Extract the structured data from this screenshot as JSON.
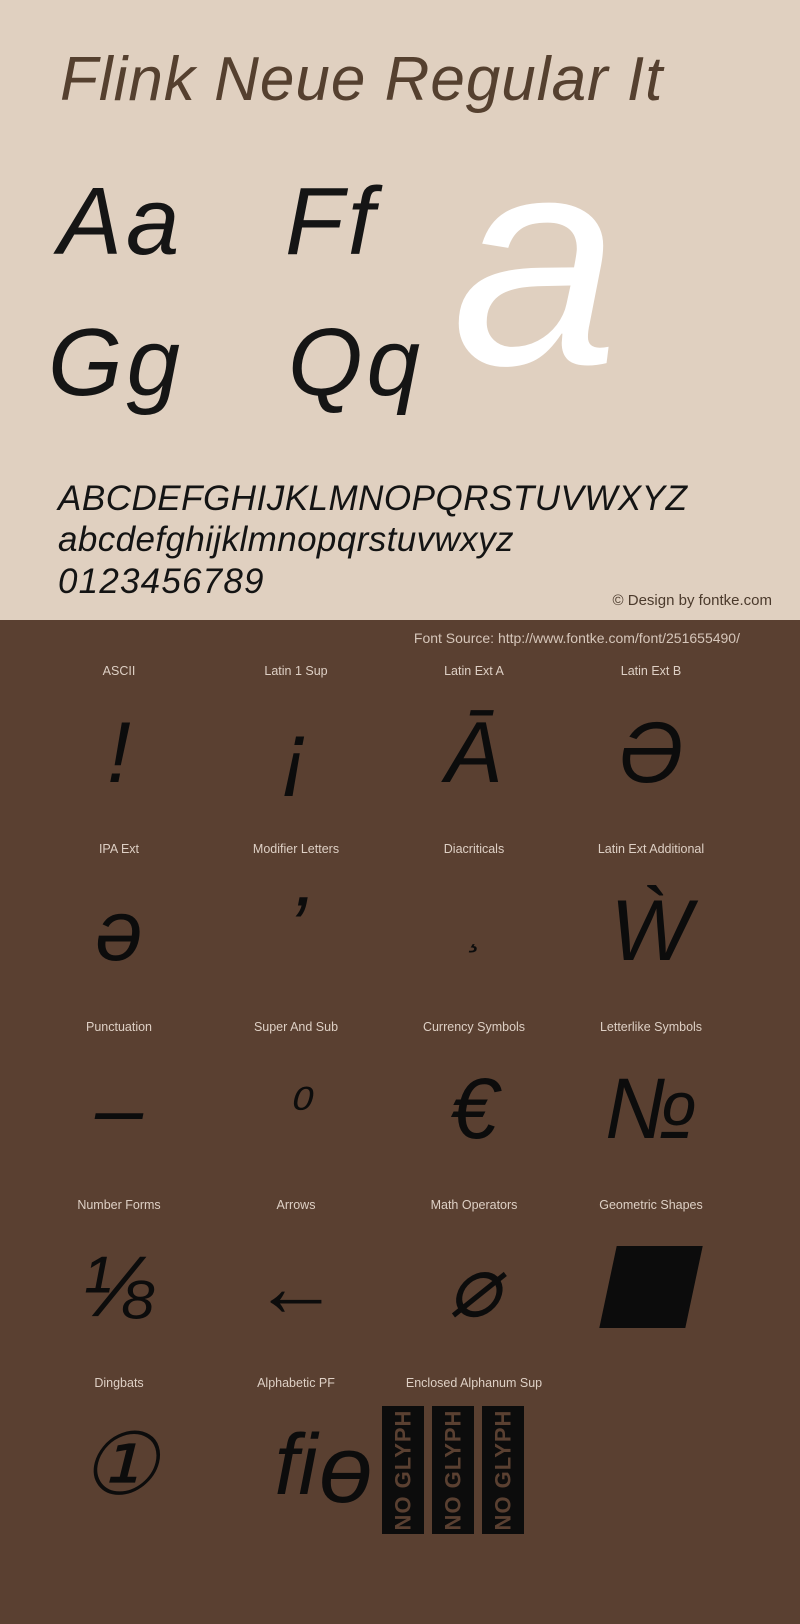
{
  "header": {
    "title": "Flink Neue Regular It"
  },
  "showcase": {
    "pairs": [
      "Aa",
      "Ff",
      "Gg",
      "Qq"
    ],
    "giant_glyph": "a"
  },
  "alphabet": {
    "uppercase": "ABCDEFGHIJKLMNOPQRSTUVWXYZ",
    "lowercase": "abcdefghijklmnopqrstuvwxyz",
    "digits": "0123456789"
  },
  "credit": "© Design by fontke.com",
  "source": "Font Source: http://www.fontke.com/font/251655490/",
  "unicode_blocks": [
    [
      {
        "label": "ASCII",
        "glyph": "!"
      },
      {
        "label": "Latin 1 Sup",
        "glyph": "¡"
      },
      {
        "label": "Latin Ext A",
        "glyph": "Ā"
      },
      {
        "label": "Latin Ext B",
        "glyph": "Ə"
      }
    ],
    [
      {
        "label": "IPA Ext",
        "glyph": "ə"
      },
      {
        "label": "Modifier Letters",
        "glyph": "ʼ"
      },
      {
        "label": "Diacriticals",
        "glyph": "̧"
      },
      {
        "label": "Latin Ext Additional",
        "glyph": "Ẁ"
      }
    ],
    [
      {
        "label": "Punctuation",
        "glyph": "–"
      },
      {
        "label": "Super And Sub",
        "glyph": "⁰"
      },
      {
        "label": "Currency Symbols",
        "glyph": "€"
      },
      {
        "label": "Letterlike Symbols",
        "glyph": "№"
      }
    ],
    [
      {
        "label": "Number Forms",
        "glyph": "⅛"
      },
      {
        "label": "Arrows",
        "glyph": "←"
      },
      {
        "label": "Math Operators",
        "glyph": "⌀"
      },
      {
        "label": "Geometric Shapes",
        "glyph": "shape-parallelogram"
      }
    ],
    [
      {
        "label": "Dingbats",
        "glyph": "①"
      },
      {
        "label": "Alphabetic PF",
        "glyph": "ﬁ"
      },
      {
        "label": "Enclosed Alphanum Sup",
        "glyph": "ɵ"
      },
      {
        "label": "",
        "glyph": ""
      }
    ]
  ],
  "no_glyph_label": "NO GLYPH",
  "no_glyph_count": 3,
  "colors": {
    "top_background": "#e0d0c0",
    "bottom_background": "#5a4031",
    "title_text": "#55402f",
    "glyph_black": "#0c0c0c",
    "giant_glyph_white": "#ffffff",
    "label_text": "#ded0c5"
  }
}
